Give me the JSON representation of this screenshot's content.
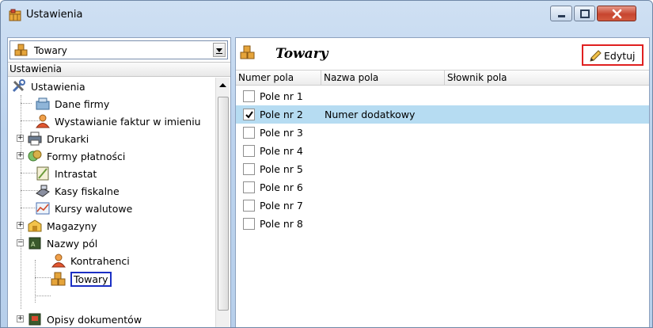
{
  "window": {
    "title": "Ustawienia"
  },
  "left": {
    "combo_value": "Towary",
    "header": "Ustawienia",
    "tree": [
      {
        "label": "Ustawienia",
        "icon": "tools-icon"
      },
      {
        "label": "Dane firmy",
        "icon": "company-data-icon"
      },
      {
        "label": "Wystawianie faktur w imieniu",
        "icon": "person-icon"
      },
      {
        "label": "Drukarki",
        "icon": "printer-icon"
      },
      {
        "label": "Formy płatności",
        "icon": "payment-icon"
      },
      {
        "label": "Intrastat",
        "icon": "intrastat-icon"
      },
      {
        "label": "Kasy fiskalne",
        "icon": "cash-register-icon"
      },
      {
        "label": "Kursy walutowe",
        "icon": "exchange-rate-icon"
      },
      {
        "label": "Magazyny",
        "icon": "warehouse-icon"
      },
      {
        "label": "Nazwy pól",
        "icon": "field-names-icon"
      },
      {
        "label": "Kontrahenci",
        "icon": "person-icon"
      },
      {
        "label": "Towary",
        "icon": "goods-icon"
      },
      {
        "label": "Opisy dokumentów",
        "icon": "document-icon"
      }
    ]
  },
  "right": {
    "title": "Towary",
    "edit_label": "Edytuj",
    "columns": [
      "Numer pola",
      "Nazwa pola",
      "Słownik pola"
    ],
    "rows": [
      {
        "pole": "Pole nr  1",
        "nazwa": "",
        "checked": false
      },
      {
        "pole": "Pole nr  2",
        "nazwa": "Numer dodatkowy",
        "checked": true
      },
      {
        "pole": "Pole nr  3",
        "nazwa": "",
        "checked": false
      },
      {
        "pole": "Pole nr  4",
        "nazwa": "",
        "checked": false
      },
      {
        "pole": "Pole nr  5",
        "nazwa": "",
        "checked": false
      },
      {
        "pole": "Pole nr  6",
        "nazwa": "",
        "checked": false
      },
      {
        "pole": "Pole nr  7",
        "nazwa": "",
        "checked": false
      },
      {
        "pole": "Pole nr  8",
        "nazwa": "",
        "checked": false
      }
    ]
  },
  "colors": {
    "selected_row": "#b6dcf2",
    "highlight_red": "#e02020",
    "highlight_blue": "#1b2fc4"
  }
}
